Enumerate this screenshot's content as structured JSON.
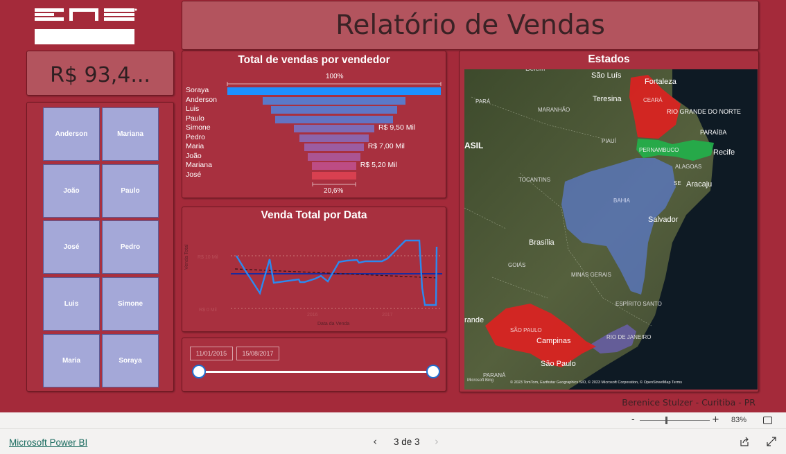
{
  "title": "Relatório de Vendas",
  "kpi": {
    "value": "R$ 93,4..."
  },
  "logo_alt": "ENS",
  "colors": {
    "background": "#a42a3a",
    "tile": "#a4a8d8",
    "accent_blue": "#1e90ff"
  },
  "sellers": [
    "Anderson",
    "Mariana",
    "João",
    "Paulo",
    "José",
    "Pedro",
    "Luis",
    "Simone",
    "Maria",
    "Soraya"
  ],
  "funnel": {
    "title": "Total de vendas por vendedor",
    "top_pct": "100%",
    "bottom_pct": "20,6%",
    "labels": {
      "simone": "R$ 9,50 Mil",
      "maria": "R$ 7,00 Mil",
      "mariana": "R$ 5,20 Mil"
    }
  },
  "line_chart": {
    "title": "Venda Total por Data",
    "ylabel": "Venda Total",
    "xlabel": "Data da Venda"
  },
  "date_slicer": {
    "start": "11/01/2015",
    "end": "15/08/2017"
  },
  "map": {
    "title": "Estados",
    "attribution": "© 2023 TomTom, Earthstar Geographics SIO, © 2023 Microsoft Corporation, © OpenStreetMap  Terms",
    "bing_label": "Microsoft Bing",
    "labels": [
      "São Luís",
      "Fortaleza",
      "Teresina",
      "CEARÁ",
      "RIO GRANDE DO NORTE",
      "PARAÍBA",
      "PARÁ",
      "MARANHÃO",
      "PIAUÍ",
      "PERNAMBUCO",
      "Recife",
      "ALAGOAS",
      "SE",
      "Aracaju",
      "TOCANTINS",
      "BAHIA",
      "Salvador",
      "Brasília",
      "GOIÁS",
      "MINAS GERAIS",
      "ESPÍRITO SANTO",
      "SÃO PAULO",
      "Campinas",
      "RIO DE JANEIRO",
      "São Paulo",
      "PARANÁ",
      "ASIL",
      "rande",
      "Belém"
    ]
  },
  "author": "Berenice Stulzer - Curitiba - PR",
  "zoom": {
    "percent": "83%"
  },
  "footer": {
    "link": "Microsoft Power BI",
    "page": "3 de 3"
  },
  "chart_data": {
    "type": "bar",
    "subtype": "funnel",
    "title": "Total de vendas por vendedor",
    "categories": [
      "Soraya",
      "Anderson",
      "Luis",
      "Paulo",
      "Simone",
      "Pedro",
      "Maria",
      "João",
      "Mariana",
      "José"
    ],
    "values": [
      25.2,
      16.8,
      14.9,
      13.9,
      9.5,
      8.2,
      7.0,
      6.2,
      5.2,
      5.2
    ],
    "value_labels": {
      "Simone": "R$ 9,50 Mil",
      "Maria": "R$ 7,00 Mil",
      "Mariana": "R$ 5,20 Mil"
    },
    "top_percent": "100%",
    "bottom_percent": "20,6%"
  }
}
